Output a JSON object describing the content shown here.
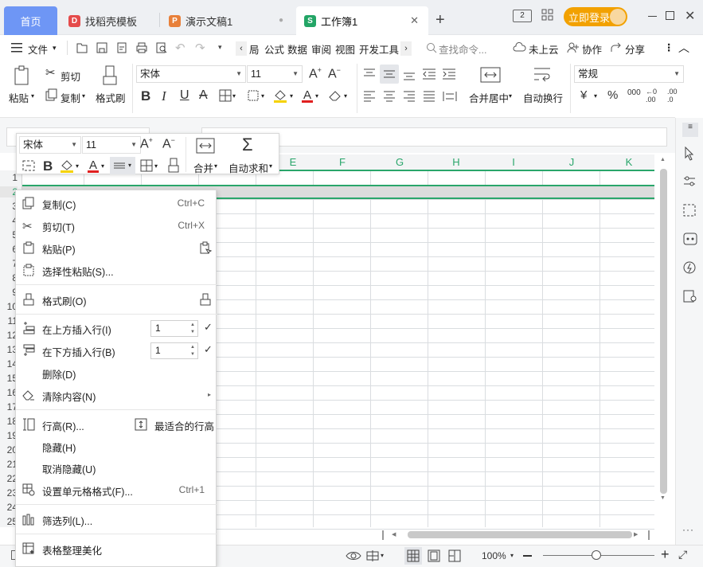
{
  "tabs": {
    "home": "首页",
    "daoke": "找稻壳模板",
    "ppt": "演示文稿1",
    "book": "工作簿1"
  },
  "login_label": "立即登录",
  "menubar": {
    "file": "文件",
    "menus": [
      "局",
      "公式",
      "数据",
      "审阅",
      "视图",
      "开发工具"
    ],
    "search_placeholder": "查找命令...",
    "cloud": "未上云",
    "collab": "协作",
    "share": "分享"
  },
  "ribbon": {
    "paste": "粘贴",
    "cut": "剪切",
    "copy": "复制",
    "format_painter": "格式刷",
    "font_name": "宋体",
    "font_size": "11",
    "merge_center": "合并居中",
    "auto_wrap": "自动换行",
    "number_format": "常规"
  },
  "minitoolbar": {
    "font_name": "宋体",
    "font_size": "11",
    "merge": "合并",
    "autosum": "自动求和"
  },
  "columns": [
    "E",
    "F",
    "G",
    "H",
    "I",
    "J",
    "K"
  ],
  "row_numbers": [
    "1",
    "2",
    "3",
    "4",
    "5",
    "6",
    "7",
    "8",
    "9",
    "10",
    "11",
    "12",
    "13",
    "14",
    "15",
    "16",
    "17",
    "18",
    "19",
    "20",
    "21",
    "22",
    "23",
    "24",
    "25"
  ],
  "context_menu": {
    "copy": {
      "label": "复制(C)",
      "shortcut": "Ctrl+C"
    },
    "cut": {
      "label": "剪切(T)",
      "shortcut": "Ctrl+X"
    },
    "paste": {
      "label": "粘贴(P)"
    },
    "paste_special": {
      "label": "选择性粘贴(S)..."
    },
    "format_painter": {
      "label": "格式刷(O)"
    },
    "insert_above": {
      "label": "在上方插入行(I)",
      "value": "1"
    },
    "insert_below": {
      "label": "在下方插入行(B)",
      "value": "1"
    },
    "delete": {
      "label": "删除(D)"
    },
    "clear": {
      "label": "清除内容(N)"
    },
    "row_height": {
      "label": "行高(R)...",
      "best_fit": "最适合的行高"
    },
    "hide": {
      "label": "隐藏(H)"
    },
    "unhide": {
      "label": "取消隐藏(U)"
    },
    "cell_format": {
      "label": "设置单元格格式(F)...",
      "shortcut": "Ctrl+1"
    },
    "filter": {
      "label": "筛选列(L)..."
    },
    "beautify": {
      "label": "表格整理美化"
    }
  },
  "status": {
    "zoom": "100%"
  },
  "colors": {
    "accent_green": "#2aa66b",
    "home_tab": "#6e96f5",
    "login": "#f2a100"
  }
}
